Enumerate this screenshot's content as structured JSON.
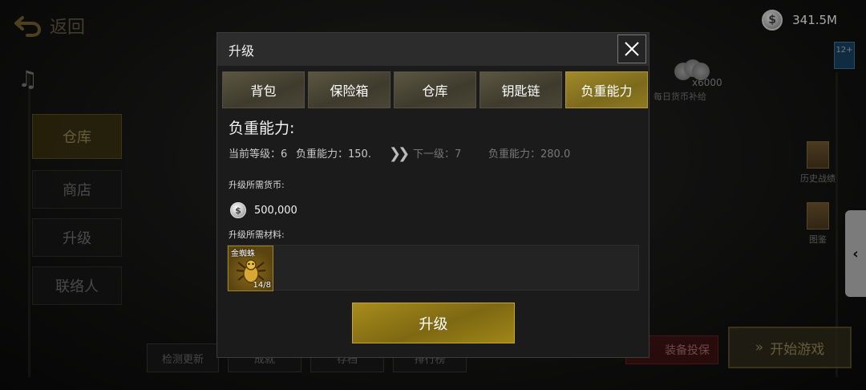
{
  "background": {
    "back_label": "返回",
    "currency_value": "341.5M",
    "coin_symbol": "$",
    "age_rating": "12+",
    "side_menu": [
      "仓库",
      "商店",
      "升级",
      "联络人"
    ],
    "daily_bonus": {
      "amount": "x6000",
      "label": "每日货币补给"
    },
    "right_tools": [
      "历史战绩",
      "图鉴"
    ],
    "bottom_buttons": [
      "检测更新",
      "成就",
      "存档",
      "排行榜"
    ],
    "insure_label": "装备投保",
    "start_label": "开始游戏"
  },
  "modal": {
    "title": "升级",
    "tabs": [
      "背包",
      "保险箱",
      "仓库",
      "钥匙链",
      "负重能力"
    ],
    "active_tab": 4,
    "section_title": "负重能力:",
    "current_level_label": "当前等级：6",
    "current_capacity_label": "负重能力：150.",
    "next_level_label": "下一级：7",
    "next_capacity_label": "负重能力：280.0",
    "cost_label": "升级所需货币:",
    "cost_value": "500,000",
    "material_label": "升级所需材料:",
    "material": {
      "name": "金蜘蛛",
      "count": "14/8"
    },
    "upgrade_button": "升级"
  },
  "colors": {
    "accent_gold": "#8f7a22",
    "tab_inactive": "#4a4636",
    "modal_bg": "#1b1b1b"
  }
}
